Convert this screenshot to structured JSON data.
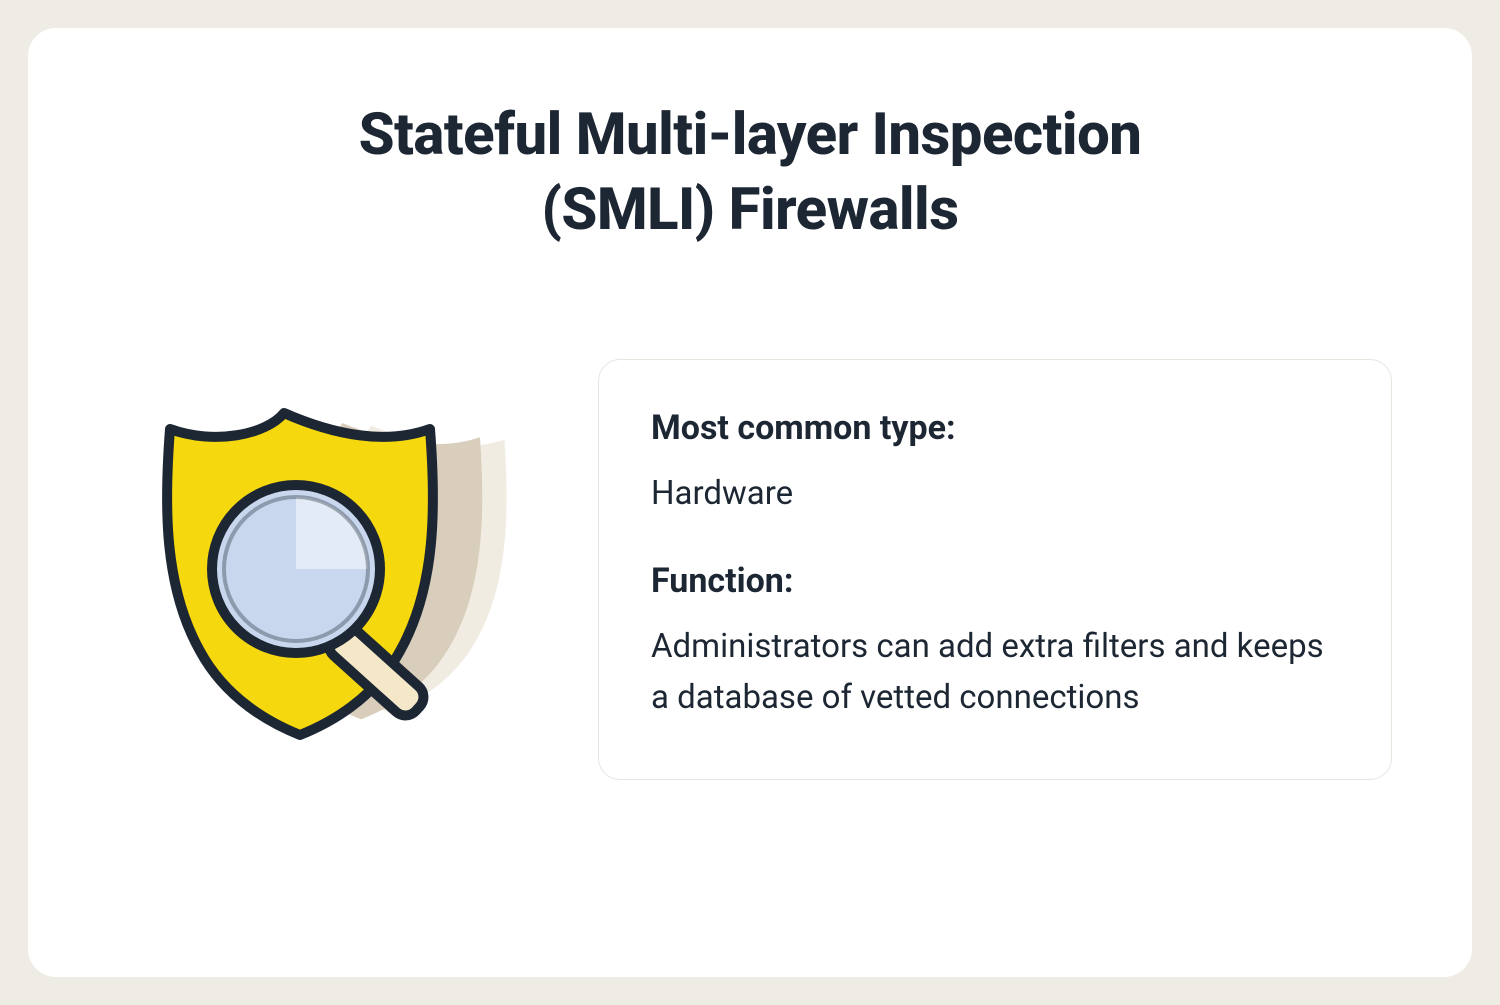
{
  "title": "Stateful Multi-layer Inspection (SMLI) Firewalls",
  "sections": [
    {
      "label": "Most common type:",
      "value": "Hardware"
    },
    {
      "label": "Function:",
      "value": "Administrators can add extra filters and keeps a database of vetted connections"
    }
  ],
  "icon": "shield-magnifier-icon",
  "colors": {
    "page_bg": "#efece6",
    "card_bg": "#ffffff",
    "text": "#1d2733",
    "border": "#e8e5df",
    "shield_accent": "#f6d80f",
    "shield_shadow1": "#d9cebb",
    "shield_shadow2": "#f1ece2",
    "lens": "#c9d7ee",
    "lens_hl": "#e3ebf6",
    "handle": "#f4e8c9",
    "stroke": "#1d2733"
  }
}
